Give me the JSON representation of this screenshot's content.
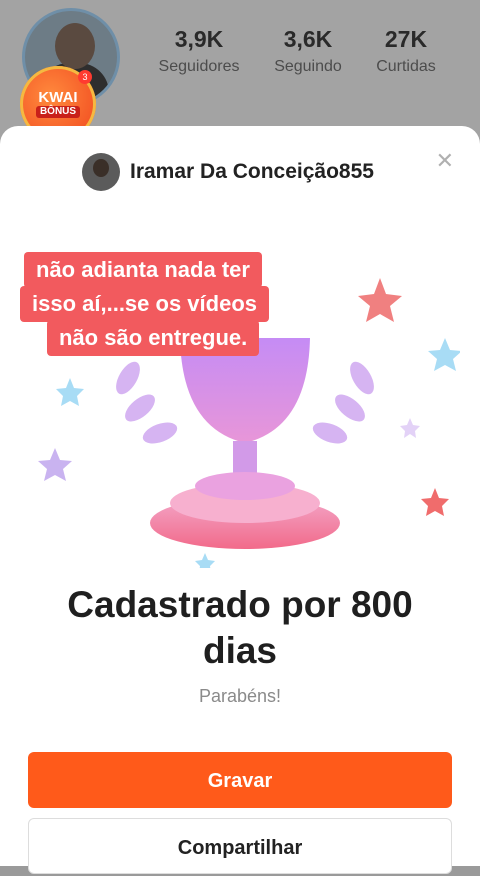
{
  "profile": {
    "stats": [
      {
        "value": "3,9K",
        "label": "Seguidores"
      },
      {
        "value": "3,6K",
        "label": "Seguindo"
      },
      {
        "value": "27K",
        "label": "Curtidas"
      }
    ],
    "badge": {
      "line1": "KWAI",
      "line2": "BÔNUS",
      "count": "3"
    }
  },
  "sheet": {
    "username": "Iramar Da Conceição855",
    "close_icon": "close-icon",
    "caption_lines": [
      "não adianta nada ter",
      "isso aí,...se  os vídeos",
      "não são entregue."
    ],
    "title": "Cadastrado por 800 dias",
    "subtitle": "Parabéns!",
    "primary_button": "Gravar",
    "secondary_button": "Compartilhar"
  },
  "colors": {
    "accent": "#ff5a1a",
    "caption_bg": "#f25a5e",
    "trophy": "#d48cf2"
  }
}
